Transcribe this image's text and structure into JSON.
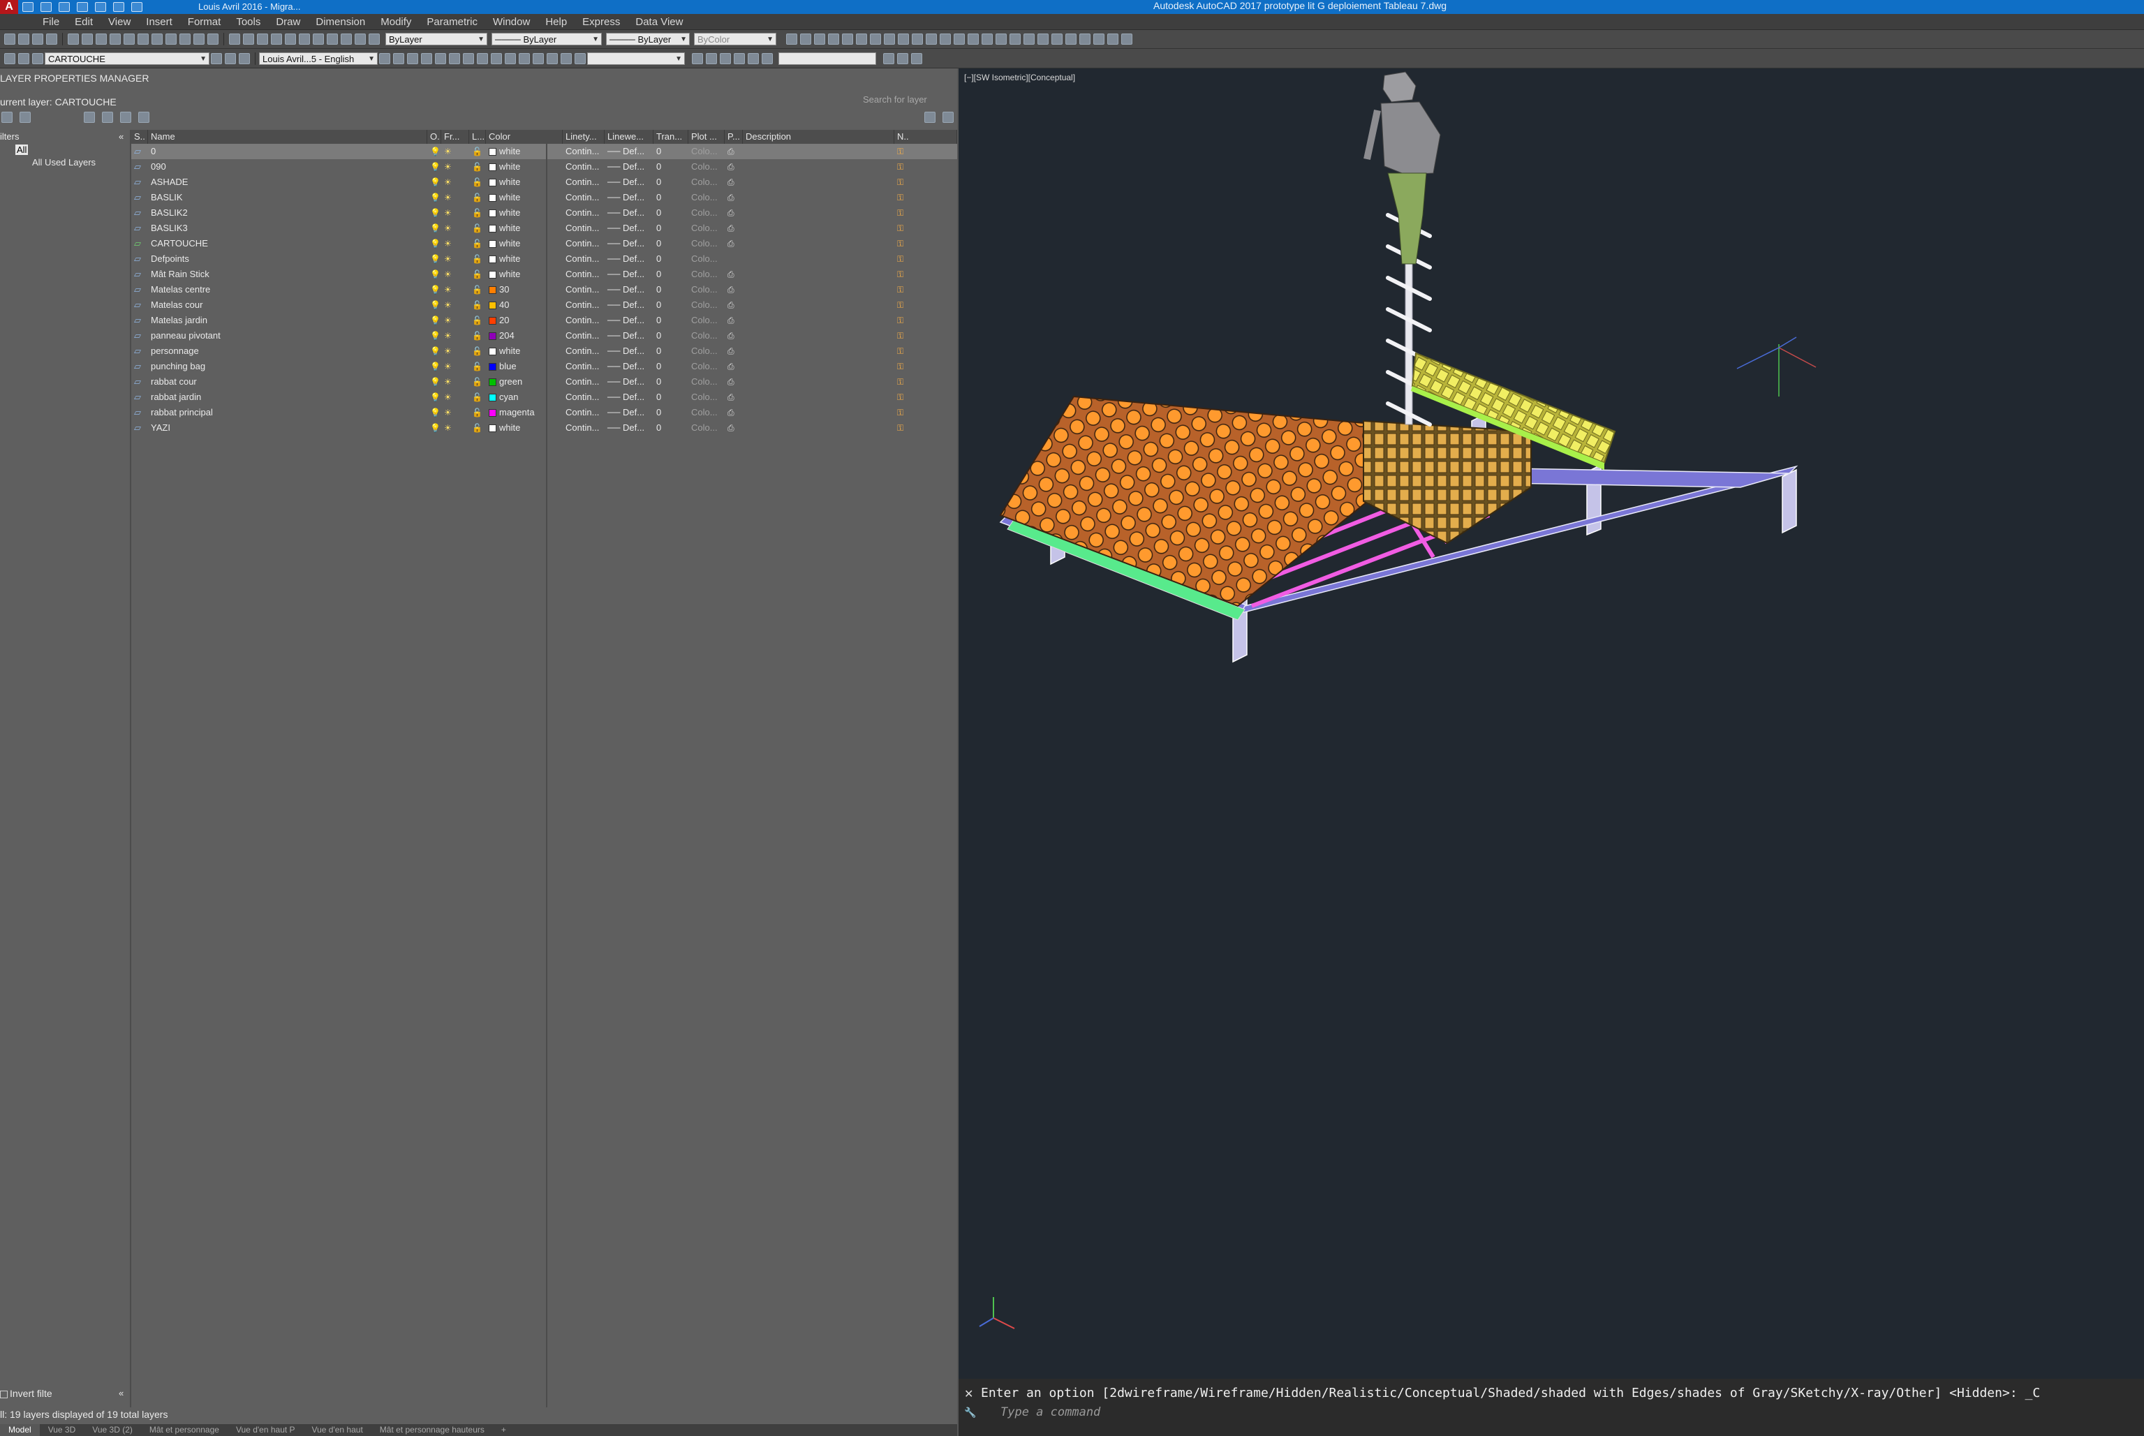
{
  "titlebar": {
    "document_tab": "Louis Avril 2016 - Migra...",
    "window_title": "Autodesk AutoCAD 2017    prototype lit G deploiement Tableau 7.dwg"
  },
  "menu": [
    "File",
    "Edit",
    "View",
    "Insert",
    "Format",
    "Tools",
    "Draw",
    "Dimension",
    "Modify",
    "Parametric",
    "Window",
    "Help",
    "Express",
    "Data View"
  ],
  "toolbar": {
    "color": "ByLayer",
    "linetype": "ByLayer",
    "lineweight": "ByLayer",
    "plotstyle": "ByColor",
    "layer_current": "CARTOUCHE",
    "textstyle": "Louis Avril...5 - English"
  },
  "panel": {
    "title": "LAYER PROPERTIES MANAGER",
    "current_layer": "urrent layer: CARTOUCHE",
    "search_placeholder": "Search for layer",
    "filters_head": "ilters",
    "filters": [
      "All",
      "All Used Layers"
    ],
    "columns": [
      "S..",
      "Name",
      "O..",
      "Fr...",
      "L...",
      "Color",
      "Linety...",
      "Linewe...",
      "Tran...",
      "Plot ...",
      "P...",
      "Description",
      "N.."
    ],
    "layers": [
      {
        "name": "0",
        "color": "white",
        "hex": "#ffffff"
      },
      {
        "name": "090",
        "color": "white",
        "hex": "#ffffff"
      },
      {
        "name": "ASHADE",
        "color": "white",
        "hex": "#ffffff"
      },
      {
        "name": "BASLIK",
        "color": "white",
        "hex": "#ffffff"
      },
      {
        "name": "BASLIK2",
        "color": "white",
        "hex": "#ffffff"
      },
      {
        "name": "BASLIK3",
        "color": "white",
        "hex": "#ffffff"
      },
      {
        "name": "CARTOUCHE",
        "color": "white",
        "hex": "#ffffff"
      },
      {
        "name": "Defpoints",
        "color": "white",
        "hex": "#ffffff"
      },
      {
        "name": "Mât Rain Stick",
        "color": "white",
        "hex": "#ffffff"
      },
      {
        "name": "Matelas centre",
        "color": "30",
        "hex": "#ff7f00"
      },
      {
        "name": "Matelas cour",
        "color": "40",
        "hex": "#ffbf00"
      },
      {
        "name": "Matelas jardin",
        "color": "20",
        "hex": "#ff3f00"
      },
      {
        "name": "panneau pivotant",
        "color": "204",
        "hex": "#8f00b8"
      },
      {
        "name": "personnage",
        "color": "white",
        "hex": "#ffffff"
      },
      {
        "name": "punching bag",
        "color": "blue",
        "hex": "#0000ff"
      },
      {
        "name": "rabbat cour",
        "color": "green",
        "hex": "#00c000"
      },
      {
        "name": "rabbat jardin",
        "color": "cyan",
        "hex": "#00ffff"
      },
      {
        "name": "rabbat principal",
        "color": "magenta",
        "hex": "#ff00ff"
      },
      {
        "name": "YAZI",
        "color": "white",
        "hex": "#ffffff"
      }
    ],
    "linetype": "Contin...",
    "lineweight": "── Def...",
    "transparency": "0",
    "plotstyle": "Colo...",
    "invert_filter": "Invert filte",
    "status": "ll: 19 layers displayed of 19 total layers"
  },
  "layout_tabs": [
    "Model",
    "Vue 3D",
    "Vue 3D (2)",
    "Mât et personnage",
    "Vue d'en haut P",
    "Vue d'en haut",
    "Mât et personnage hauteurs",
    "+"
  ],
  "viewport": {
    "label": "[−][SW Isometric][Conceptual]"
  },
  "command": {
    "history": "Enter an option [2dwireframe/Wireframe/Hidden/Realistic/Conceptual/Shaded/shaded with Edges/shades of Gray/SKetchy/X-ray/Other] <Hidden>: _C",
    "placeholder": "Type a command"
  },
  "colors": {
    "accent": "#0f6fc6",
    "viewport_bg": "#212830",
    "panel_bg": "#5f5f5f"
  }
}
